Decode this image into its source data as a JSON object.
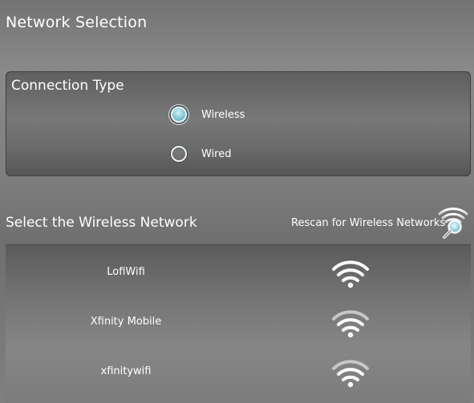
{
  "page": {
    "title": "Network Selection"
  },
  "connection": {
    "title": "Connection Type",
    "options": [
      {
        "label": "Wireless",
        "selected": true
      },
      {
        "label": "Wired",
        "selected": false
      }
    ]
  },
  "networks": {
    "heading": "Select the Wireless Network",
    "rescan_label": "Rescan for Wireless Networks",
    "rescan_icon": "wifi-search-icon",
    "items": [
      {
        "name": "LofiWifi",
        "icon": "wifi-signal-icon"
      },
      {
        "name": "Xfinity Mobile",
        "icon": "wifi-signal-icon"
      },
      {
        "name": "xfinitywifi",
        "icon": "wifi-signal-icon"
      }
    ]
  },
  "colors": {
    "accent": "#8fcfdc",
    "text": "#ffffff"
  }
}
